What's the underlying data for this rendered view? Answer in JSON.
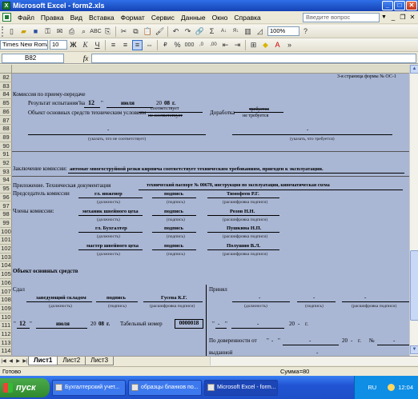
{
  "window": {
    "title": "Microsoft Excel - form2.xls"
  },
  "menu": {
    "items": [
      "Файл",
      "Правка",
      "Вид",
      "Вставка",
      "Формат",
      "Сервис",
      "Данные",
      "Окно",
      "Справка"
    ],
    "help_placeholder": "Введите вопрос"
  },
  "toolbar": {
    "zoom": "100%"
  },
  "format_toolbar": {
    "font": "Times New Roman",
    "size": "10",
    "bold": "Ж",
    "italic": "К",
    "underline": "Ч"
  },
  "formula_bar": {
    "name_box": "B82",
    "fx": "fx",
    "value": ""
  },
  "rows": [
    "82",
    "83",
    "84",
    "85",
    "86",
    "87",
    "88",
    "89",
    "90",
    "91",
    "92",
    "93",
    "94",
    "95",
    "96",
    "97",
    "98",
    "99",
    "100",
    "101",
    "102",
    "103",
    "104",
    "105",
    "106",
    "107",
    "108",
    "109",
    "110",
    "111",
    "112",
    "113",
    "114"
  ],
  "form": {
    "page_header": "3-я страница формы № ОС-1",
    "commission_title": "Комиссия по приему-передаче",
    "test_result": "Результат испытания на",
    "q1": "\"",
    "day": "12",
    "q2": "\"",
    "month": "июля",
    "year_prefix": "20",
    "year": "08",
    "year_suffix": "г.",
    "object_conditions": "Объект основных средств техническим условиям",
    "complies": "соответствует",
    "not_complies": "не соответствует",
    "refinement": "Доработка",
    "required": "требуется",
    "not_required": "не требуется",
    "dash_left": "-",
    "dash_right": "-",
    "note_left": "(указать, что не соответствует)",
    "note_right": "(указать, что требуется)",
    "conclusion_label": "Заключение комиссии:",
    "conclusion_text": "автомат многоструйной резки кирпича соответствует техническим требованиям, пригоден к эксплуатации.",
    "attachment_label": "Приложение. Техническая документация",
    "attachment_text": "технический паспорт № 00678, инструкция по эксплуатации, кинематическая схема",
    "chairman_label": "Председатель комиссии",
    "members_label": "Члены комиссии:",
    "position_caption": "(должность)",
    "signature_caption": "(подпись)",
    "decoding_caption": "(расшифровка подписи)",
    "signature_word": "подпись",
    "chairman": {
      "position": "гл. инженер",
      "name": "Тимофеев Р.Г."
    },
    "members": [
      {
        "position": "механик швейного цеха",
        "name": "Розов Н.Н."
      },
      {
        "position": "гл. Бухгалтер",
        "name": "Пушкина Н.П."
      },
      {
        "position": "мастер швейного цеха",
        "name": "Полушин В.Л."
      }
    ],
    "fixed_asset_object": "Объект основных средств",
    "handed": "Сдал",
    "accepted": "Принял",
    "handed_position": "заведующий складом",
    "handed_name": "Гусева К.Г.",
    "handed_day": "12",
    "handed_month": "июля",
    "handed_year": "08",
    "tab_number_label": "Табельный номер",
    "tab_number": "0000018",
    "accepted_dashes": [
      "-",
      "-",
      "-"
    ],
    "accepted_date_dash1": "-",
    "accepted_date_dash2": "-",
    "accepted_year_dash": "-",
    "power_of_attorney": "По доверенности от",
    "poa_dash1": "-",
    "poa_dash2": "-",
    "poa_year_prefix": "20",
    "poa_year_dash": "-",
    "poa_year_suffix": "г.",
    "poa_number": "№",
    "poa_number_dash": "-",
    "issued": "выданной",
    "poa_issued_dash": "-"
  },
  "sheets": [
    "Лист1",
    "Лист2",
    "Лист3"
  ],
  "status": {
    "ready": "Готово",
    "sum": "Сумма=80"
  },
  "taskbar": {
    "start": "пуск",
    "tasks": [
      "Бухгалтерский учет...",
      "образцы бланков по...",
      "Microsoft Excel - form..."
    ],
    "lang": "RU",
    "clock": "12:04"
  }
}
